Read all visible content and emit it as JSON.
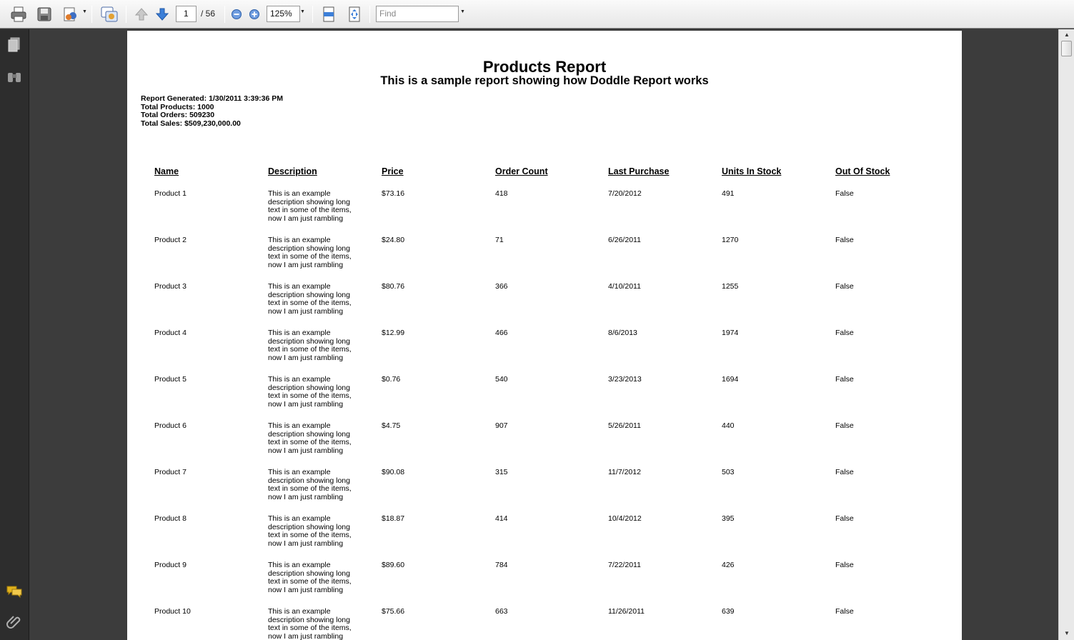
{
  "toolbar": {
    "page_current": "1",
    "page_total": "/ 56",
    "zoom": "125%",
    "find_placeholder": "Find"
  },
  "report": {
    "title": "Products Report",
    "subtitle": "This is a sample report showing how Doddle Report works",
    "meta": [
      "Report Generated: 1/30/2011 3:39:36 PM",
      "Total Products: 1000",
      "Total Orders: 509230",
      "Total Sales: $509,230,000.00"
    ],
    "columns": [
      "Name",
      "Description",
      "Price",
      "Order Count",
      "Last Purchase",
      "Units In Stock",
      "Out Of Stock"
    ],
    "description_lines": [
      "This is an example",
      "description showing long",
      "text in some of the items,",
      "now I am just rambling"
    ],
    "rows": [
      {
        "name": "Product 1",
        "price": "$73.16",
        "orders": "418",
        "last": "7/20/2012",
        "units": "491",
        "oos": "False"
      },
      {
        "name": "Product 2",
        "price": "$24.80",
        "orders": "71",
        "last": "6/26/2011",
        "units": "1270",
        "oos": "False"
      },
      {
        "name": "Product 3",
        "price": "$80.76",
        "orders": "366",
        "last": "4/10/2011",
        "units": "1255",
        "oos": "False"
      },
      {
        "name": "Product 4",
        "price": "$12.99",
        "orders": "466",
        "last": "8/6/2013",
        "units": "1974",
        "oos": "False"
      },
      {
        "name": "Product 5",
        "price": "$0.76",
        "orders": "540",
        "last": "3/23/2013",
        "units": "1694",
        "oos": "False"
      },
      {
        "name": "Product 6",
        "price": "$4.75",
        "orders": "907",
        "last": "5/26/2011",
        "units": "440",
        "oos": "False"
      },
      {
        "name": "Product 7",
        "price": "$90.08",
        "orders": "315",
        "last": "11/7/2012",
        "units": "503",
        "oos": "False"
      },
      {
        "name": "Product 8",
        "price": "$18.87",
        "orders": "414",
        "last": "10/4/2012",
        "units": "395",
        "oos": "False"
      },
      {
        "name": "Product 9",
        "price": "$89.60",
        "orders": "784",
        "last": "7/22/2011",
        "units": "426",
        "oos": "False"
      },
      {
        "name": "Product 10",
        "price": "$75.66",
        "orders": "663",
        "last": "11/26/2011",
        "units": "639",
        "oos": "False"
      }
    ]
  },
  "icons": {
    "print": "print-icon",
    "save": "save-icon",
    "sign": "sign-icon",
    "collaborate": "collaborate-icon",
    "prev": "arrow-up-icon",
    "next": "arrow-down-icon",
    "zoom_out": "zoom-out-icon",
    "zoom_in": "zoom-in-icon",
    "fit_width": "fit-width-icon",
    "fit_page": "fit-page-icon",
    "pages": "pages-icon",
    "search": "binoculars-icon",
    "comments": "comments-icon",
    "attachments": "paperclip-icon"
  }
}
